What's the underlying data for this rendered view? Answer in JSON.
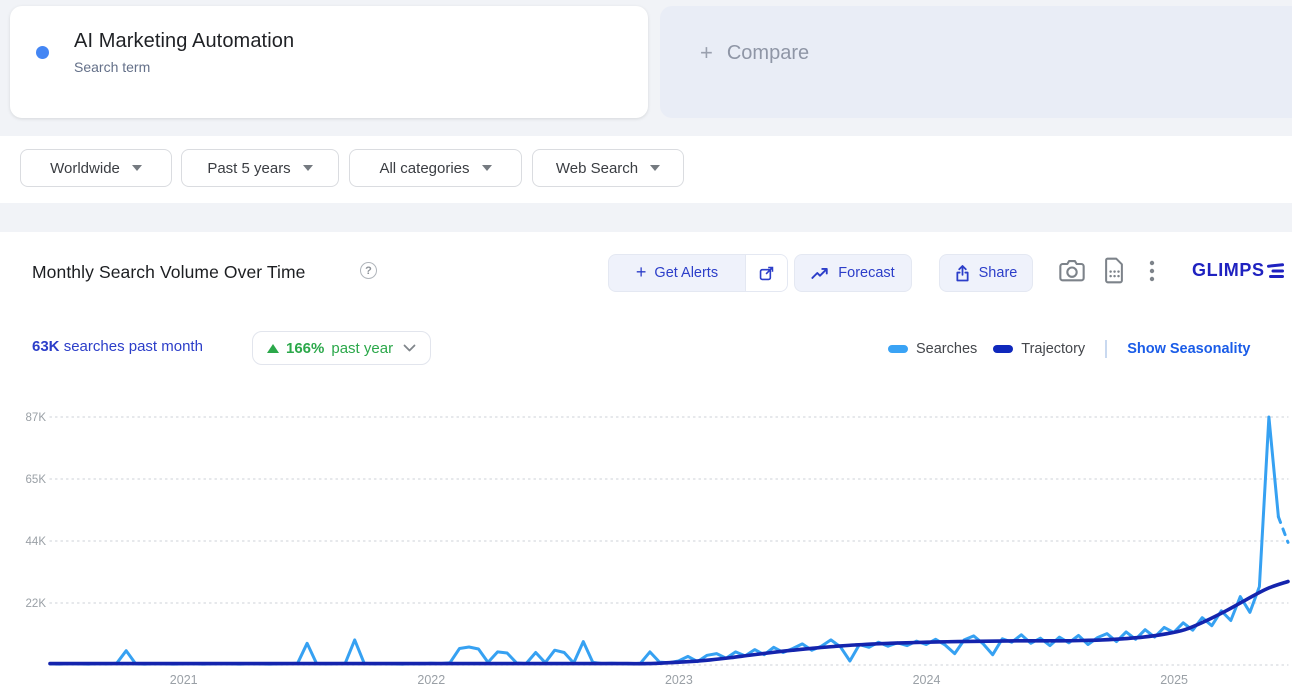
{
  "term_card": {
    "title": "AI Marketing Automation",
    "subtitle": "Search term",
    "dot_color": "#4486f4"
  },
  "compare_card": {
    "plus": "+",
    "label": "Compare"
  },
  "filters": [
    {
      "label": "Worldwide"
    },
    {
      "label": "Past 5 years"
    },
    {
      "label": "All categories"
    },
    {
      "label": "Web Search"
    }
  ],
  "chart_header": {
    "title": "Monthly Search Volume Over Time",
    "help": "?",
    "get_alerts_label": "Get Alerts",
    "get_alerts_plus": "+",
    "forecast_label": "Forecast",
    "share_label": "Share",
    "logo": "GLIMPS"
  },
  "stats": {
    "value": "63K",
    "caption": " searches past month",
    "change_percent": "166%",
    "change_period": "past year"
  },
  "legend": {
    "items": [
      {
        "label": "Searches",
        "color": "#3aa3f5"
      },
      {
        "label": "Trajectory",
        "color": "#0f28bc"
      }
    ],
    "link": "Show Seasonality"
  },
  "chart_data": {
    "type": "line",
    "title": "Monthly Search Volume Over Time",
    "unit": "searches (thousands)",
    "x_range": [
      2020.46,
      2025.46
    ],
    "ylim": [
      0,
      91
    ],
    "grid": "dotted horizontal",
    "legend_position": "top-right",
    "x_ticks": [
      2021,
      2022,
      2023,
      2024,
      2025
    ],
    "y_ticks": [
      {
        "label": "22K",
        "value": 21.75
      },
      {
        "label": "44K",
        "value": 43.5
      },
      {
        "label": "65K",
        "value": 65.25
      },
      {
        "label": "87K",
        "value": 87
      },
      {
        "label": "",
        "value": 0
      }
    ],
    "series": [
      {
        "name": "Searches",
        "color": "#36a1f2",
        "width": 3,
        "smooth": false,
        "start": 2020.46,
        "step": 0.03846,
        "dashed_from_index": 129,
        "values": [
          0.4,
          0.3,
          0.5,
          0.4,
          0.3,
          0.5,
          0.4,
          0.6,
          5.0,
          0.4,
          0.3,
          0.5,
          0.4,
          0.3,
          0.4,
          0.5,
          0.3,
          0.4,
          0.5,
          0.4,
          0.3,
          0.5,
          0.4,
          0.3,
          0.4,
          0.5,
          0.6,
          7.6,
          0.5,
          0.4,
          0.5,
          0.6,
          8.8,
          0.6,
          0.4,
          0.5,
          0.4,
          0.3,
          0.5,
          0.4,
          0.6,
          0.5,
          0.8,
          5.8,
          6.3,
          5.6,
          0.9,
          4.6,
          4.2,
          0.7,
          0.5,
          4.4,
          0.8,
          5.2,
          4.4,
          0.7,
          8.2,
          0.9,
          0.5,
          0.6,
          0.5,
          0.4,
          0.6,
          4.6,
          1.0,
          0.8,
          1.4,
          3.0,
          1.2,
          3.4,
          4.0,
          2.4,
          4.6,
          3.2,
          5.4,
          3.6,
          6.2,
          4.4,
          5.8,
          7.4,
          5.2,
          6.6,
          8.8,
          6.4,
          1.4,
          7.2,
          6.2,
          8.0,
          6.6,
          7.8,
          6.8,
          8.4,
          7.2,
          9.0,
          7.0,
          4.0,
          8.8,
          10.2,
          7.4,
          3.6,
          9.2,
          8.0,
          10.6,
          7.6,
          9.4,
          6.8,
          9.8,
          7.8,
          10.4,
          7.2,
          9.6,
          11.0,
          8.2,
          11.6,
          9.0,
          12.4,
          9.8,
          13.2,
          11.4,
          14.8,
          12.2,
          16.6,
          13.8,
          19.0,
          15.6,
          24.0,
          18.5,
          27.5,
          87.0,
          52.0,
          43.0
        ]
      },
      {
        "name": "Trajectory",
        "color": "#1424ad",
        "width": 3.6,
        "smooth": true,
        "start": 2020.46,
        "step": 0.08333,
        "values": [
          0.5,
          0.5,
          0.5,
          0.5,
          0.5,
          0.5,
          0.5,
          0.5,
          0.5,
          0.5,
          0.5,
          0.5,
          0.5,
          0.5,
          0.5,
          0.5,
          0.5,
          0.5,
          0.5,
          0.5,
          0.5,
          0.5,
          0.5,
          0.5,
          0.5,
          0.5,
          0.5,
          0.5,
          0.5,
          0.5,
          0.8,
          1.2,
          1.8,
          2.6,
          3.5,
          4.4,
          5.2,
          5.9,
          6.5,
          7.0,
          7.4,
          7.7,
          7.9,
          8.1,
          8.2,
          8.3,
          8.4,
          8.5,
          8.5,
          8.5,
          8.6,
          8.8,
          9.2,
          9.8,
          10.8,
          12.4,
          15.4,
          19.0,
          23.0,
          26.8,
          29.3
        ]
      }
    ]
  }
}
